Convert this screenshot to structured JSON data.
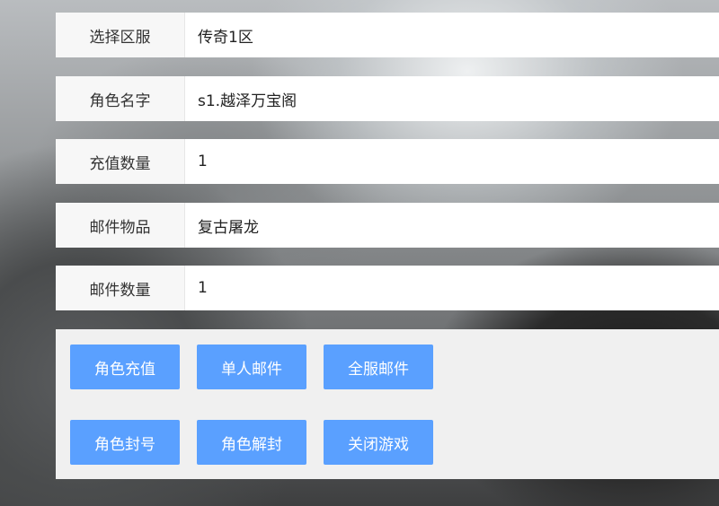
{
  "form": {
    "fields": [
      {
        "label": "选择区服",
        "value": "传奇1区"
      },
      {
        "label": "角色名字",
        "value": "s1.越泽万宝阁"
      },
      {
        "label": "充值数量",
        "value": "1"
      },
      {
        "label": "邮件物品",
        "value": "复古屠龙"
      },
      {
        "label": "邮件数量",
        "value": "1"
      }
    ]
  },
  "actions": {
    "recharge_label": "角色充值",
    "single_mail_label": "单人邮件",
    "server_mail_label": "全服邮件",
    "ban_label": "角色封号",
    "unban_label": "角色解封",
    "close_game_label": "关闭游戏"
  },
  "colors": {
    "button_bg": "#5aa0ff",
    "label_bg": "#f7f7f7",
    "panel_bg": "#f0f0f0"
  }
}
